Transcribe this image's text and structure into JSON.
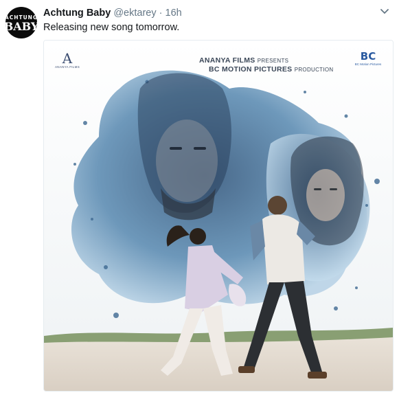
{
  "tweet": {
    "display_name": "Achtung Baby",
    "handle": "@ektarey",
    "separator": "·",
    "time": "16h",
    "text": "Releasing new song tomorrow.",
    "avatar": {
      "line1": "ACHTUNG",
      "line2": "BABY"
    },
    "menu_icon": "chevron-down-icon"
  },
  "poster": {
    "credit_line1_main": "ANANYA FILMS",
    "credit_line1_small": "PRESENTS",
    "credit_line2_main": "BC MOTION PICTURES",
    "credit_line2_small": "PRODUCTION",
    "left_logo_mark": "A",
    "left_logo_text": "ANANYA FILMS",
    "right_logo_mark": "BC",
    "right_logo_text": "BC Motion Pictures"
  },
  "colors": {
    "text": "#14171a",
    "secondary": "#657786",
    "border": "#e6ecf0",
    "watercolor_blue": "#4f7fa6"
  }
}
